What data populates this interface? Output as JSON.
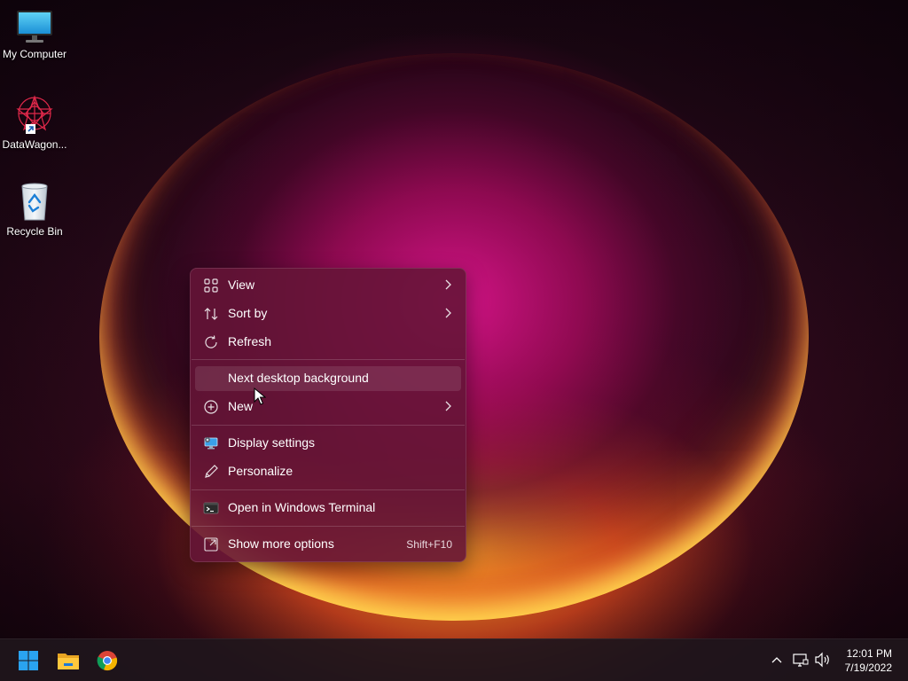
{
  "desktop_icons": [
    {
      "label": "My Computer",
      "icon": "monitor-icon"
    },
    {
      "label": "DataWagon...",
      "icon": "datawagon-app-icon"
    },
    {
      "label": "Recycle Bin",
      "icon": "recycle-bin-icon"
    }
  ],
  "context_menu": {
    "items": [
      {
        "label": "View",
        "icon": "grid-icon",
        "submenu": true
      },
      {
        "label": "Sort by",
        "icon": "sort-arrows-icon",
        "submenu": true
      },
      {
        "label": "Refresh",
        "icon": "refresh-icon",
        "submenu": false
      },
      {
        "label": "Next desktop background",
        "icon": "",
        "submenu": false
      },
      {
        "label": "New",
        "icon": "plus-circle-icon",
        "submenu": true
      },
      {
        "label": "Display settings",
        "icon": "display-settings-icon",
        "submenu": false
      },
      {
        "label": "Personalize",
        "icon": "pen-icon",
        "submenu": false
      },
      {
        "label": "Open in Windows Terminal",
        "icon": "terminal-icon",
        "submenu": false
      },
      {
        "label": "Show more options",
        "icon": "expand-icon",
        "shortcut": "Shift+F10"
      }
    ]
  },
  "taskbar": {
    "apps": [
      {
        "name": "Start",
        "icon": "windows-start-icon"
      },
      {
        "name": "File Explorer",
        "icon": "folder-icon"
      },
      {
        "name": "Google Chrome",
        "icon": "chrome-icon"
      }
    ],
    "tray_icons": [
      "chevron-up-icon",
      "network-icon",
      "volume-icon"
    ],
    "clock": {
      "time": "12:01 PM",
      "date": "7/19/2022"
    }
  },
  "colors": {
    "menu_bg": "#64143a",
    "accent_blue": "#0078d4",
    "taskbar_bg": "#20161c"
  }
}
